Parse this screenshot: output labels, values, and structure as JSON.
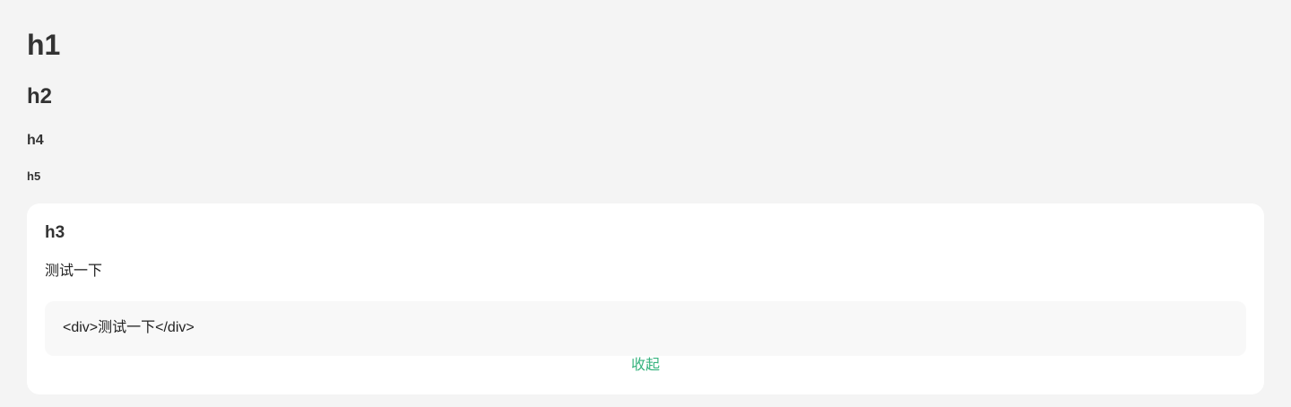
{
  "headings": {
    "h1": "h1",
    "h2": "h2",
    "h4": "h4",
    "h5": "h5"
  },
  "card": {
    "title": "h3",
    "demo_text": "测试一下",
    "code": "<div>测试一下</div>",
    "collapse_label": "收起"
  },
  "colors": {
    "page_background": "#f4f4f4",
    "card_background": "#ffffff",
    "code_background": "#f8f8f8",
    "link_accent": "#36b37e",
    "heading_text": "#333333"
  }
}
